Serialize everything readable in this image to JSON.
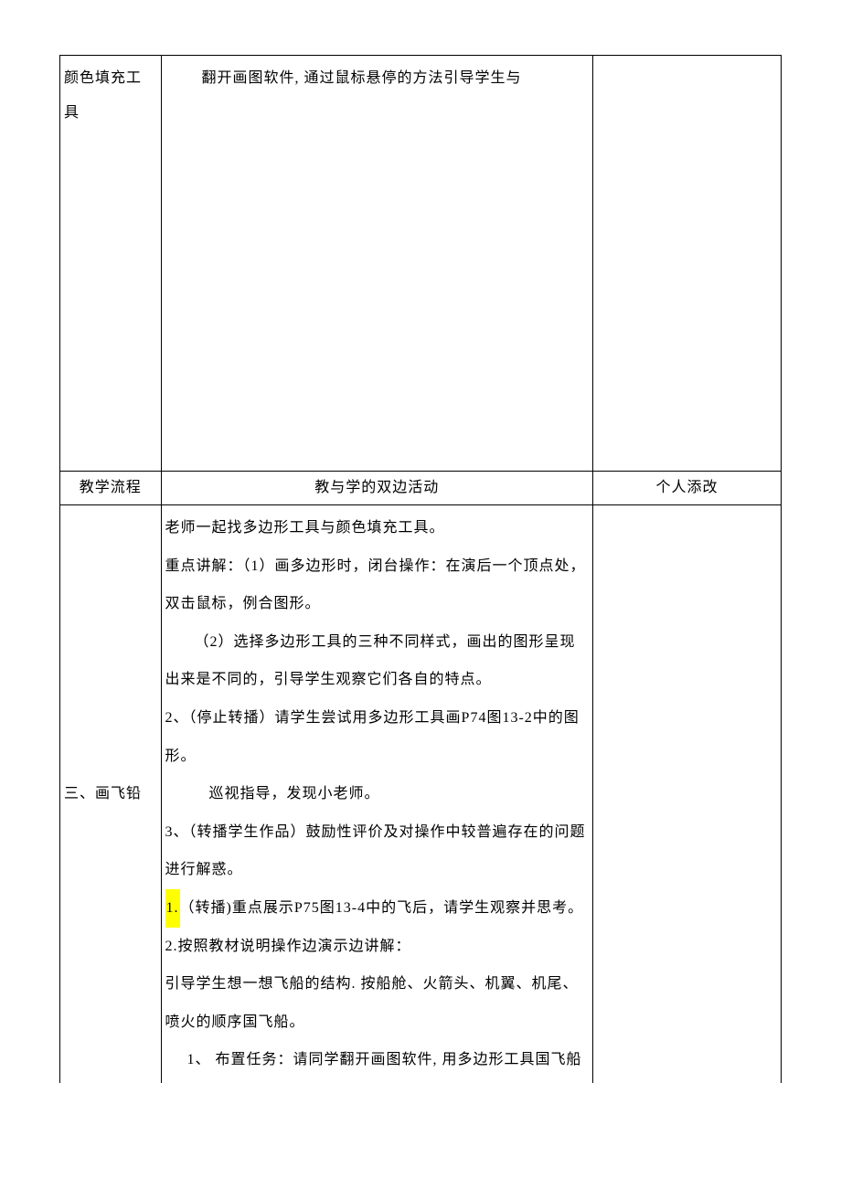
{
  "row1": {
    "col1": "颜色填充工具",
    "col2_line1": "翻开画图软件, 通过鼠标悬停的方法引导学生与"
  },
  "row2": {
    "col1": "教学流程",
    "col2": "教与学的双边活动",
    "col3": "个人添改"
  },
  "row3": {
    "col1": "三、画飞铅",
    "body": {
      "p1": "老师一起找多边形工具与颜色填充工具。",
      "p2": "重点讲解：（1）画多边形时，闭台操作：在演后一个顶点处，双击鼠标，例合图形。",
      "p3": "（2）选择多边形工具的三种不同样式，画出的图形呈现出来是不同的，引导学生观察它们各自的特点。",
      "p4": "2、（停止转播）请学生尝试用多边形工具画P74图13-2中的图形。",
      "p5": "巡视指导，发现小老师。",
      "p6": "3、（转播学生作品）鼓励性评价及对操作中较普遍存在的问题进行解惑。",
      "p7_hl": "1.",
      "p7_rest": "（转播)重点展示P75图13-4中的飞后，请学生观察并思考。",
      "p8": "2.按照教材说明操作边演示边讲解：",
      "p9": "引导学生想一想飞船的结构. 按船舱、火箭头、机翼、机尾、喷火的顺序国飞船。",
      "p10": "1、    布置任务：请同学翻开画图软件, 用多边形工具国飞船"
    }
  }
}
